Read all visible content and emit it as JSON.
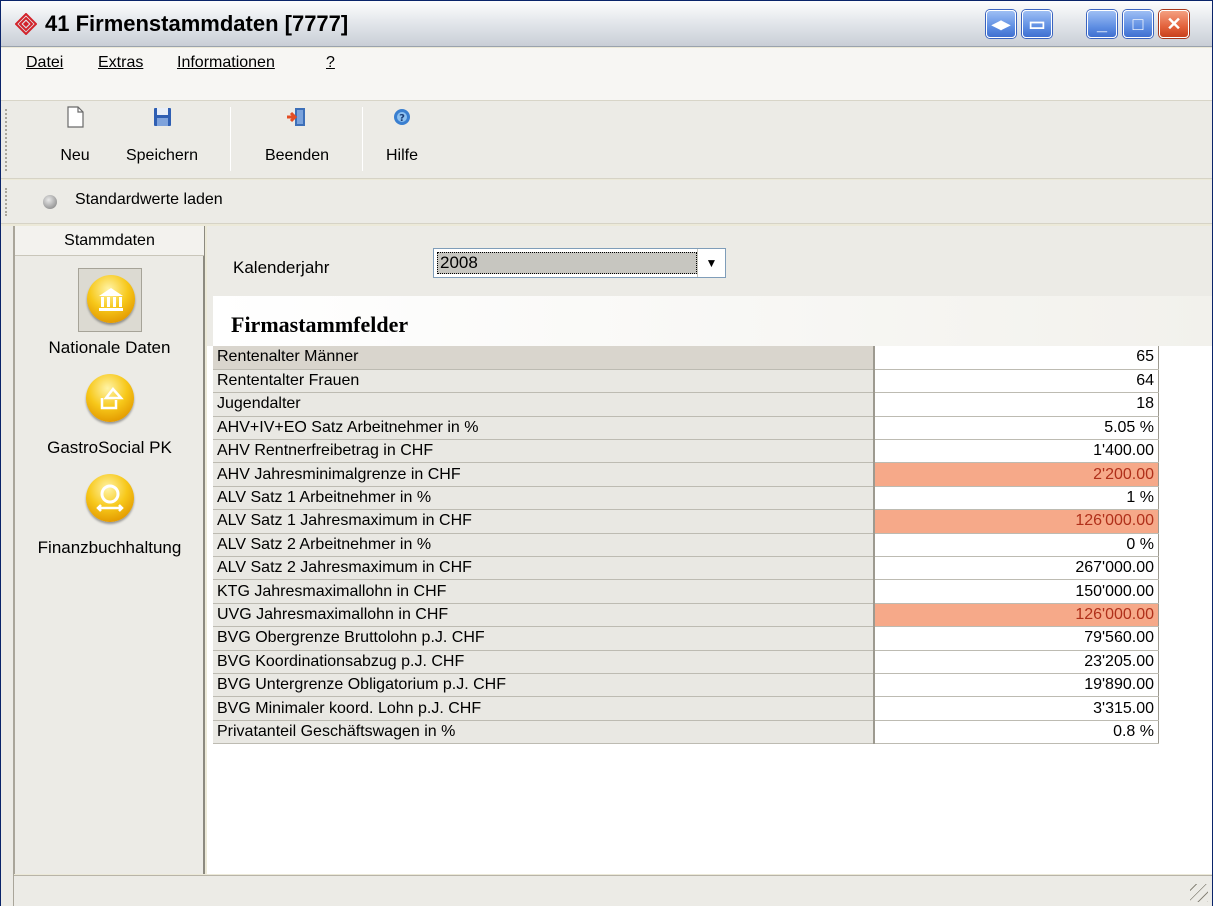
{
  "window": {
    "title": "41 Firmenstammdaten [7777]"
  },
  "menu": {
    "items": [
      {
        "label": "Datei"
      },
      {
        "label": "Extras"
      },
      {
        "label": "Informationen"
      },
      {
        "label": "?"
      }
    ]
  },
  "toolbar": {
    "new_label": "Neu",
    "save_label": "Speichern",
    "exit_label": "Beenden",
    "help_label": "Hilfe",
    "load_defaults_label": "Standardwerte laden"
  },
  "sidebar": {
    "header": "Stammdaten",
    "items": [
      {
        "label": "Nationale Daten",
        "icon": "bank-icon",
        "active": true
      },
      {
        "label": "GastroSocial PK",
        "icon": "house-arrow-icon",
        "active": false
      },
      {
        "label": "Finanzbuchhaltung",
        "icon": "cycle-icon",
        "active": false
      }
    ]
  },
  "filter": {
    "label": "Kalenderjahr",
    "value": "2008"
  },
  "section": {
    "title": "Firmastammfelder"
  },
  "colors": {
    "highlight": "#f6a989",
    "highlight_text": "#b0301a"
  },
  "rows": [
    {
      "label": "Rentenalter Männer",
      "value": "65",
      "highlight": false
    },
    {
      "label": "Rententalter Frauen",
      "value": "64",
      "highlight": false
    },
    {
      "label": "Jugendalter",
      "value": "18",
      "highlight": false
    },
    {
      "label": "AHV+IV+EO Satz Arbeitnehmer in %",
      "value": "5.05 %",
      "highlight": false
    },
    {
      "label": "AHV Rentnerfreibetrag in CHF",
      "value": "1'400.00",
      "highlight": false
    },
    {
      "label": "AHV Jahresminimalgrenze in CHF",
      "value": "2'200.00",
      "highlight": true
    },
    {
      "label": "ALV Satz 1 Arbeitnehmer in %",
      "value": "1 %",
      "highlight": false
    },
    {
      "label": "ALV Satz 1 Jahresmaximum in CHF",
      "value": "126'000.00",
      "highlight": true
    },
    {
      "label": "ALV Satz 2 Arbeitnehmer in %",
      "value": "0 %",
      "highlight": false
    },
    {
      "label": "ALV Satz 2 Jahresmaximum in CHF",
      "value": "267'000.00",
      "highlight": false
    },
    {
      "label": "KTG Jahresmaximallohn in CHF",
      "value": "150'000.00",
      "highlight": false
    },
    {
      "label": "UVG Jahresmaximallohn in CHF",
      "value": "126'000.00",
      "highlight": true
    },
    {
      "label": "BVG Obergrenze Bruttolohn p.J. CHF",
      "value": "79'560.00",
      "highlight": false
    },
    {
      "label": "BVG Koordinationsabzug p.J. CHF",
      "value": "23'205.00",
      "highlight": false
    },
    {
      "label": "BVG Untergrenze Obligatorium p.J. CHF",
      "value": "19'890.00",
      "highlight": false
    },
    {
      "label": "BVG Minimaler koord. Lohn p.J. CHF",
      "value": "3'315.00",
      "highlight": false
    },
    {
      "label": "Privatanteil Geschäftswagen in %",
      "value": "0.8 %",
      "highlight": false
    }
  ]
}
